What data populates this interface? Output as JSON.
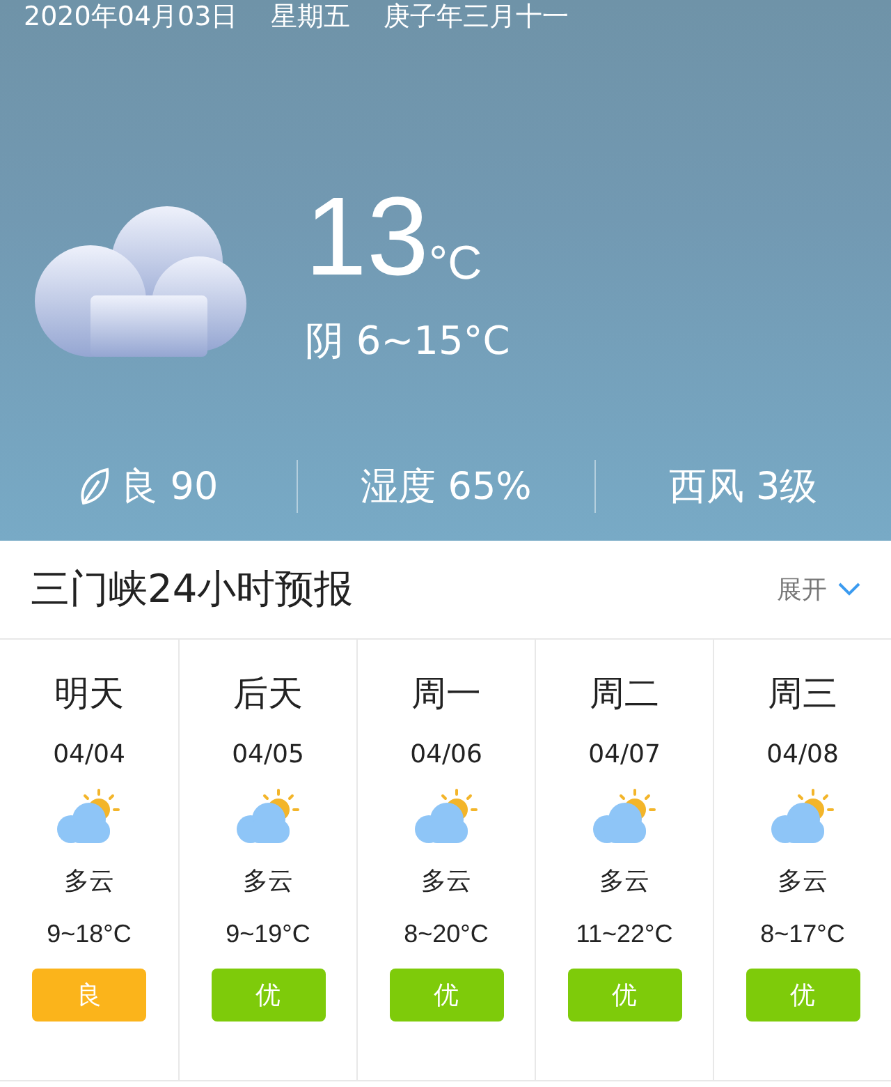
{
  "header": {
    "date": "2020年04月03日",
    "weekday": "星期五",
    "lunar": "庚子年三月十一"
  },
  "current": {
    "temperature": "13",
    "unit": "°C",
    "summary": "阴 6~15°C"
  },
  "stats": [
    {
      "kind": "air",
      "text": "良 90"
    },
    {
      "kind": "plain",
      "text": "湿度 65%"
    },
    {
      "kind": "plain",
      "text": "西风 3级"
    }
  ],
  "forecast": {
    "title": "三门峡24小时预报",
    "toggle": "展开",
    "days": [
      {
        "day": "明天",
        "date": "04/04",
        "condition": "多云",
        "range": "9~18°C",
        "aqi": "良",
        "color": "#fbb41b"
      },
      {
        "day": "后天",
        "date": "04/05",
        "condition": "多云",
        "range": "9~19°C",
        "aqi": "优",
        "color": "#7ecb0a"
      },
      {
        "day": "周一",
        "date": "04/06",
        "condition": "多云",
        "range": "8~20°C",
        "aqi": "优",
        "color": "#7ecb0a"
      },
      {
        "day": "周二",
        "date": "04/07",
        "condition": "多云",
        "range": "11~22°C",
        "aqi": "优",
        "color": "#7ecb0a"
      },
      {
        "day": "周三",
        "date": "04/08",
        "condition": "多云",
        "range": "8~17°C",
        "aqi": "优",
        "color": "#7ecb0a"
      }
    ]
  }
}
